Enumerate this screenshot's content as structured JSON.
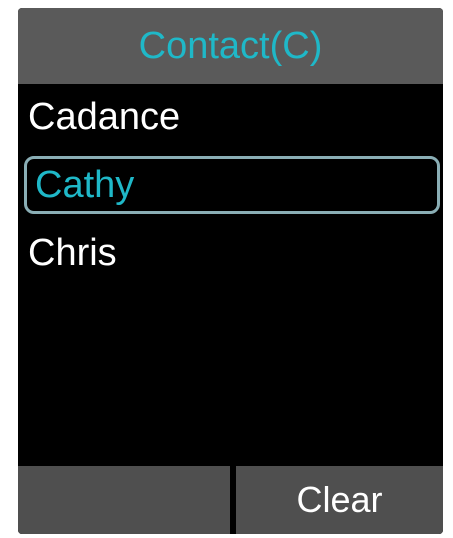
{
  "header": {
    "title": "Contact(C)"
  },
  "contacts": [
    {
      "name": "Cadance",
      "selected": false
    },
    {
      "name": "Cathy",
      "selected": true
    },
    {
      "name": "Chris",
      "selected": false
    }
  ],
  "softkeys": {
    "left_label": "",
    "right_label": "Clear"
  },
  "colors": {
    "accent": "#1fb8c8",
    "title_bar": "#5a5a5a",
    "softkey_bg": "#4f4f4f",
    "selection_border": "#8aaeb5",
    "screen_bg": "#000000",
    "text": "#ffffff"
  }
}
